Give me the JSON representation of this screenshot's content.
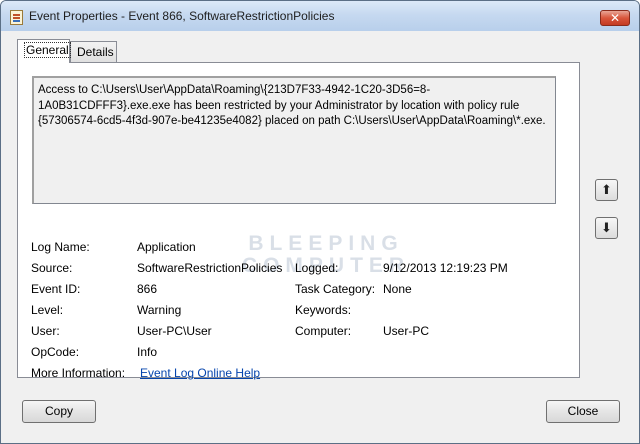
{
  "window": {
    "title": "Event Properties - Event 866, SoftwareRestrictionPolicies",
    "close_glyph": "✕"
  },
  "tabs": [
    "General",
    "Details"
  ],
  "message": "Access to C:\\Users\\User\\AppData\\Roaming\\{213D7F33-4942-1C20-3D56=8-\n1A0B31CDFFF3}.exe.exe has been restricted by your Administrator by location with policy rule\n{57306574-6cd5-4f3d-907e-be41235e4082} placed on path C:\\Users\\User\\AppData\\Roaming\\*.exe.",
  "watermark": "BLEEPING COMPUTER",
  "fields": {
    "log_name": {
      "label": "Log Name:",
      "value": "Application"
    },
    "source": {
      "label": "Source:",
      "value": "SoftwareRestrictionPolicies"
    },
    "logged": {
      "label": "Logged:",
      "value": "9/12/2013 12:19:23 PM"
    },
    "event_id": {
      "label": "Event ID:",
      "value": "866"
    },
    "task_category": {
      "label": "Task Category:",
      "value": "None"
    },
    "level": {
      "label": "Level:",
      "value": "Warning"
    },
    "keywords": {
      "label": "Keywords:",
      "value": ""
    },
    "user": {
      "label": "User:",
      "value": "User-PC\\User"
    },
    "computer": {
      "label": "Computer:",
      "value": "User-PC"
    },
    "opcode": {
      "label": "OpCode:",
      "value": "Info"
    },
    "more_info": {
      "label": "More Information:",
      "value": "Event Log Online Help"
    }
  },
  "nav": {
    "up_icon": "arrow-up",
    "down_icon": "arrow-down",
    "up_glyph": "⬆",
    "down_glyph": "⬇"
  },
  "buttons": {
    "copy": "Copy",
    "close": "Close"
  }
}
